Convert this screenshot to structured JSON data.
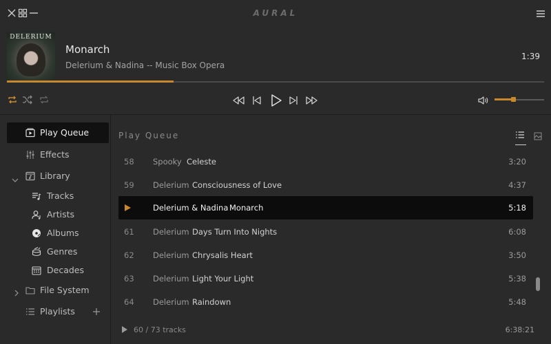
{
  "app": {
    "title": "AURAL"
  },
  "now_playing": {
    "album_art_text": "DELERIUM",
    "title": "Monarch",
    "artist_album": "Delerium & Nadina -- Music Box Opera",
    "time": "1:39",
    "progress": 0.31
  },
  "volume": {
    "level": 0.38
  },
  "colors": {
    "accent": "#c8892e",
    "background": "#2a2a2a",
    "playing_row": "#0c0c0c"
  },
  "sidebar": {
    "play_queue": "Play Queue",
    "effects": "Effects",
    "library": "Library",
    "tracks": "Tracks",
    "artists": "Artists",
    "albums": "Albums",
    "genres": "Genres",
    "decades": "Decades",
    "file_system": "File System",
    "playlists": "Playlists"
  },
  "queue": {
    "header": "Play Queue",
    "rows": [
      {
        "num": "58",
        "artist": "Spooky",
        "title": "Celeste",
        "duration": "3:20"
      },
      {
        "num": "59",
        "artist": "Delerium",
        "title": "Consciousness of Love",
        "duration": "4:37"
      },
      {
        "num": "",
        "artist": "Delerium & Nadina",
        "title": "Monarch",
        "duration": "5:18",
        "playing": true
      },
      {
        "num": "61",
        "artist": "Delerium",
        "title": "Days Turn Into Nights",
        "duration": "6:08"
      },
      {
        "num": "62",
        "artist": "Delerium",
        "title": "Chrysalis Heart",
        "duration": "3:50"
      },
      {
        "num": "63",
        "artist": "Delerium",
        "title": "Light Your Light",
        "duration": "5:38"
      },
      {
        "num": "64",
        "artist": "Delerium",
        "title": "Raindown",
        "duration": "5:48"
      }
    ],
    "track_count": "60 / 73 tracks",
    "total_duration": "6:38:21"
  }
}
